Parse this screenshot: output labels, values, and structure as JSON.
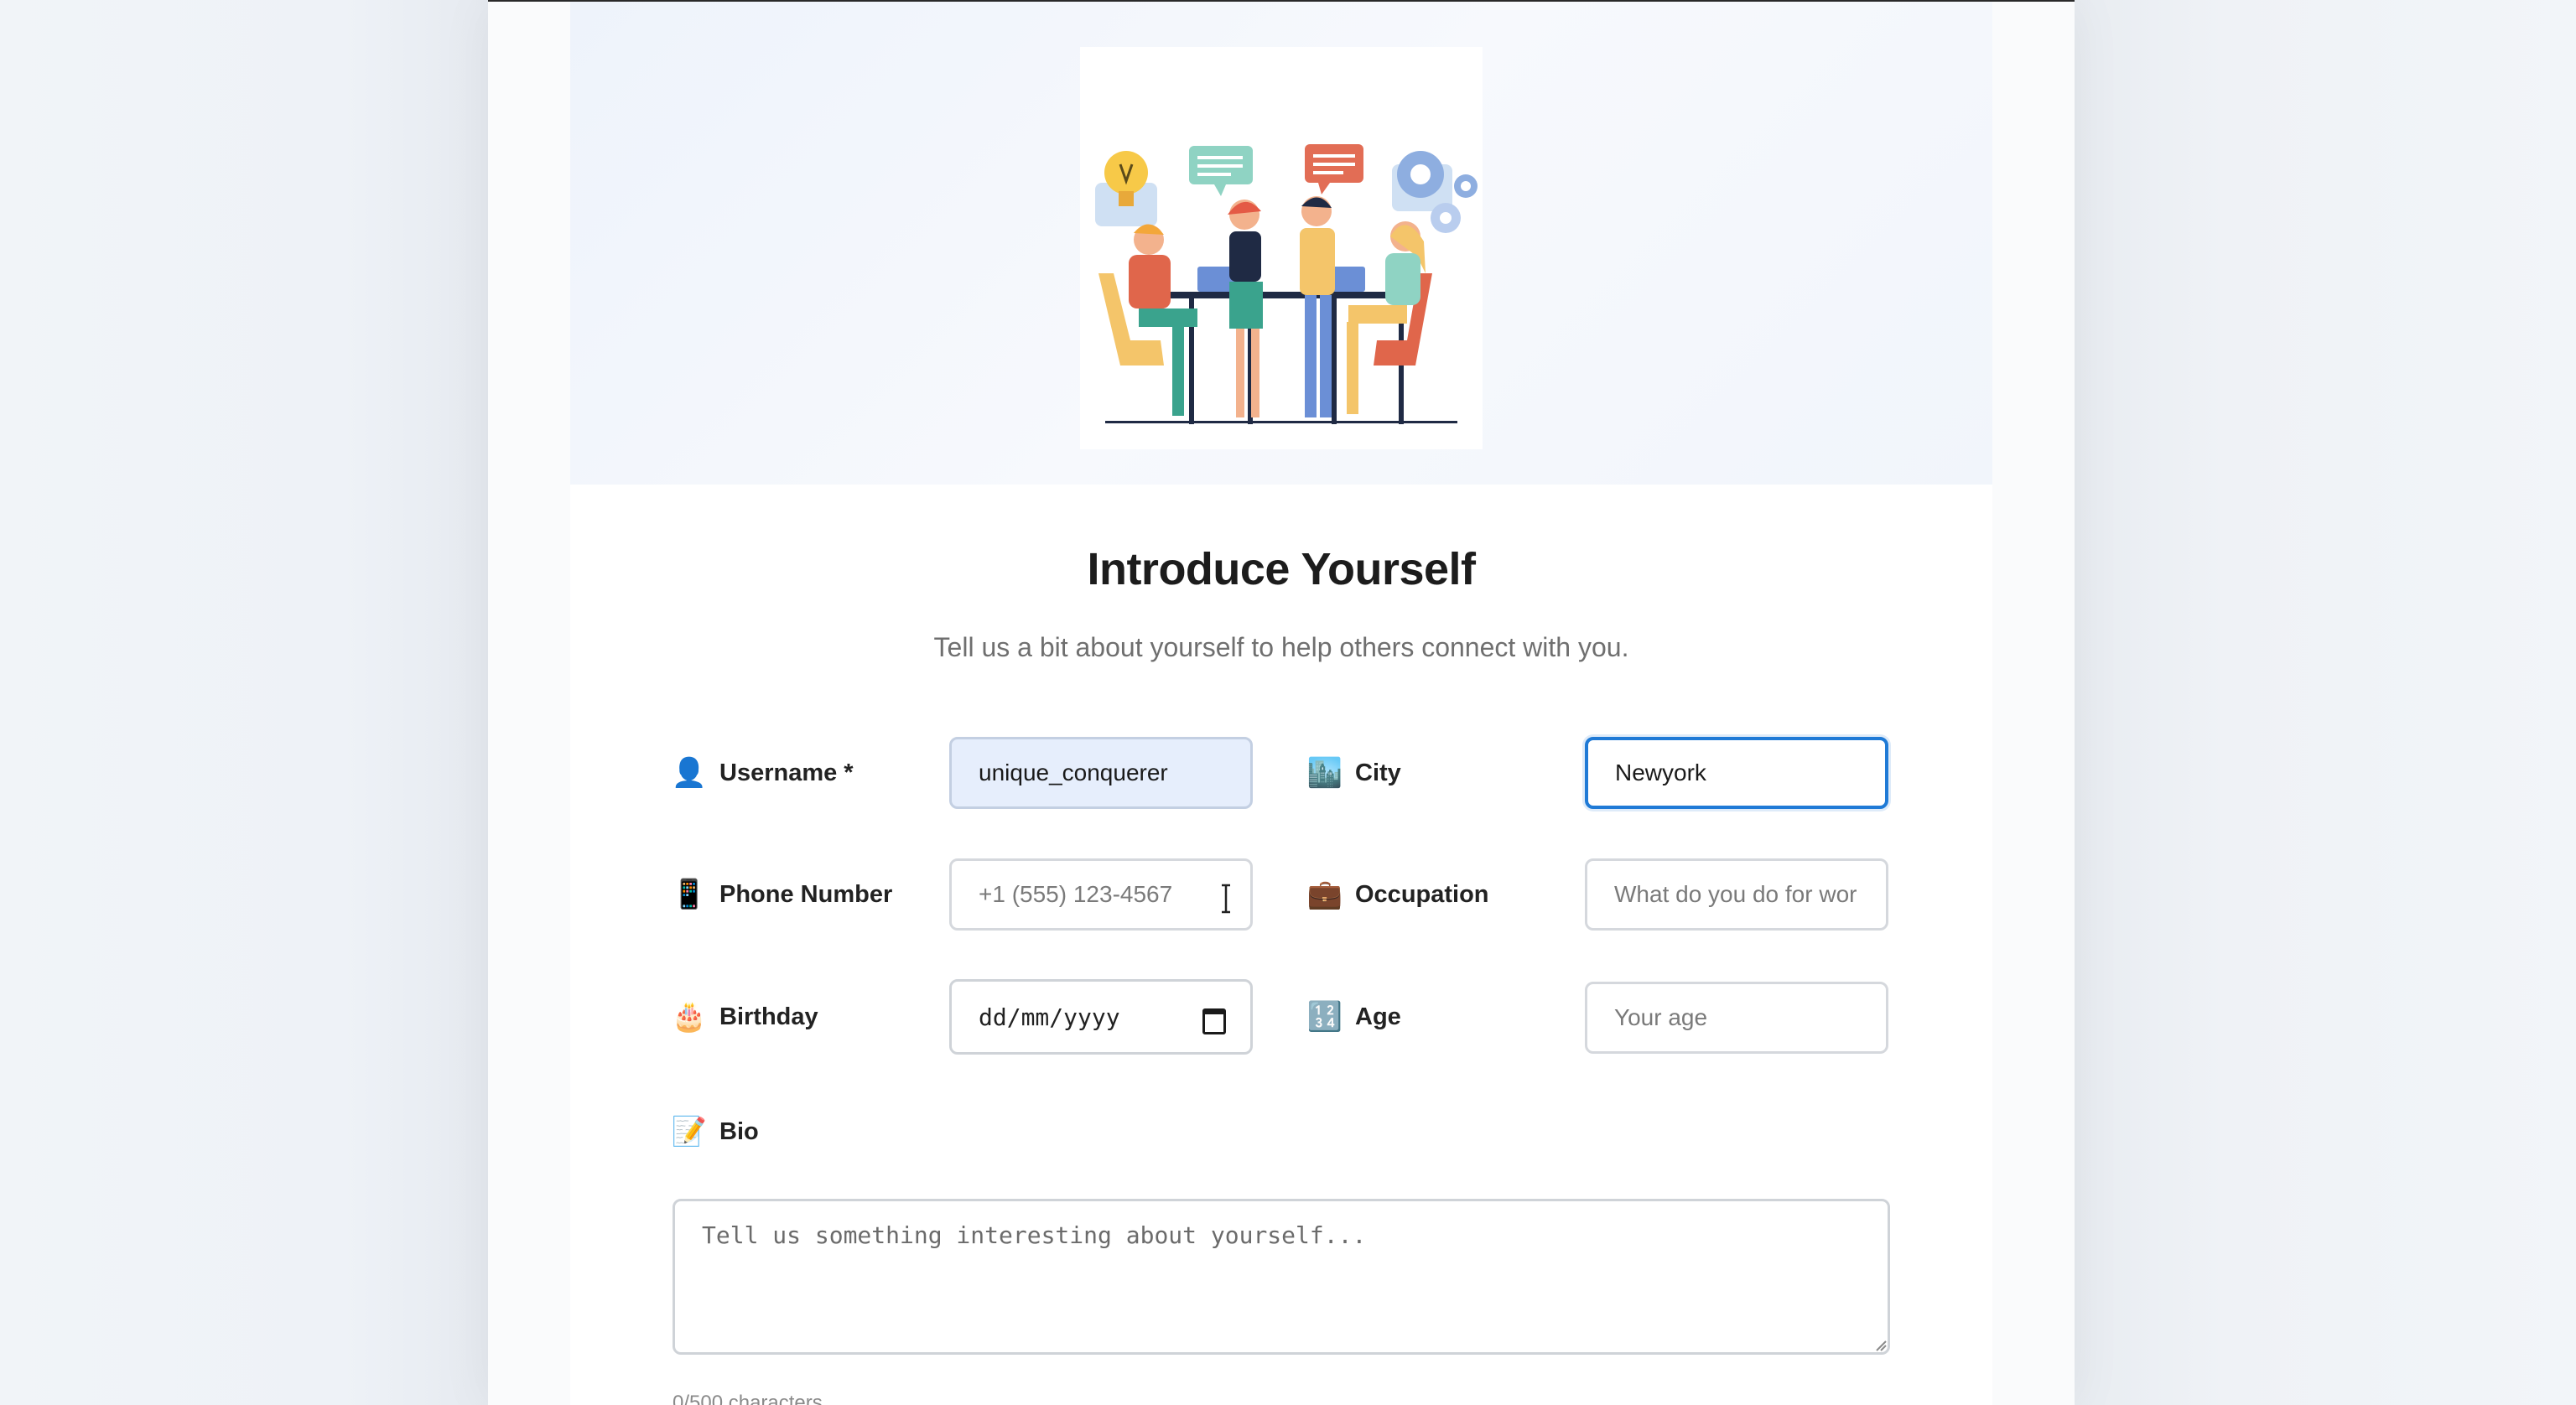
{
  "page": {
    "title": "Introduce Yourself",
    "subtitle": "Tell us a bit about yourself to help others connect with you."
  },
  "fields": {
    "username": {
      "label": "Username *",
      "icon": "person-icon",
      "value": "unique_conquerer"
    },
    "city": {
      "label": "City",
      "icon": "city-icon",
      "value": "Newyork"
    },
    "phone": {
      "label": "Phone Number",
      "icon": "phone-icon",
      "placeholder": "+1 (555) 123-4567"
    },
    "occupation": {
      "label": "Occupation",
      "icon": "briefcase-icon",
      "placeholder": "What do you do for wor"
    },
    "birthday": {
      "label": "Birthday",
      "icon": "cake-icon",
      "placeholder": "dd/mm/yyyy"
    },
    "age": {
      "label": "Age",
      "icon": "numbers-icon",
      "placeholder": "Your age"
    },
    "bio": {
      "label": "Bio",
      "icon": "memo-icon",
      "placeholder": "Tell us something interesting about yourself...",
      "counter": "0/500 characters"
    }
  },
  "colors": {
    "accent": "#1f7ad6",
    "filled_bg": "#e6eefc",
    "border": "#d5d8dd"
  }
}
